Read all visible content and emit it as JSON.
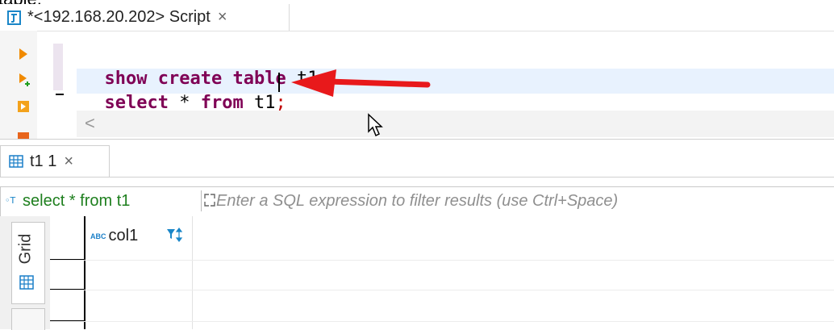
{
  "top_fragment": "table.",
  "script_tab": {
    "title": "*<192.168.20.202> Script",
    "close": "×"
  },
  "editor": {
    "lines": [
      {
        "kw1": "show",
        "kw2": "create",
        "kw3": "table",
        "ident": "t1",
        "semi": ";"
      },
      {
        "kw1": "select",
        "star": "*",
        "kw2": "from",
        "ident": "t1",
        "semi": ";"
      }
    ],
    "scroll_left": "<"
  },
  "results_tab": {
    "title": "t1 1",
    "close": "×"
  },
  "filter": {
    "query_label": "select * from t1",
    "placeholder": "Enter a SQL expression to filter results (use Ctrl+Space)"
  },
  "grid": {
    "side_tab_label": "Grid",
    "columns": [
      {
        "type_badge": "ABC",
        "name": "col1"
      }
    ]
  },
  "colors": {
    "keyword": "#7f0055",
    "semicolon": "#c00000",
    "arrow": "#e8191b",
    "filter_label": "#1e7f1e",
    "current_line": "#e8f2fe"
  }
}
